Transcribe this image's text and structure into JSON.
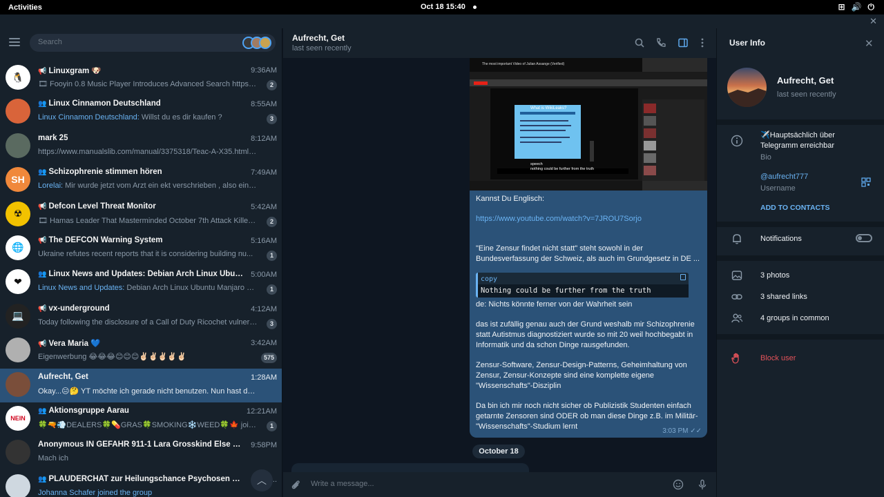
{
  "topbar": {
    "activities": "Activities",
    "clock": "Oct 18  15:40"
  },
  "search": {
    "placeholder": "Search"
  },
  "chats": [
    {
      "kind": "channel",
      "name": "Linuxgram 🐶",
      "time": "9:36AM",
      "preview_icon": "🎞",
      "preview": "Fooyin 0.8 Music Player Introduces Advanced Search https://l...",
      "sender": "",
      "badge": "2",
      "avatar_color": "#ffffff",
      "avatar_text": "🐧"
    },
    {
      "kind": "group",
      "name": "Linux Cinnamon Deutschland",
      "time": "8:55AM",
      "preview": "Willst du es dir kaufen ?",
      "sender": "Linux Cinnamon Deutschland:",
      "badge": "3",
      "avatar_color": "#d9643a",
      "avatar_text": ""
    },
    {
      "kind": "",
      "name": "mark 25",
      "time": "8:12AM",
      "preview": "https://www.manualslib.com/manual/3375318/Teac-A-X35.html?pag...",
      "sender": "",
      "badge": "",
      "avatar_color": "#5a6a60",
      "avatar_text": ""
    },
    {
      "kind": "group",
      "name": "Schizophrenie stimmen hören",
      "time": "7:49AM",
      "preview": "Mir wurde jetzt vom Arzt ein ekt verschrieben , also eine Str...",
      "sender": "Lorelai:",
      "badge": "",
      "avatar_color": "#f0883b",
      "avatar_text": "SH"
    },
    {
      "kind": "channel",
      "name": "Defcon Level Threat Monitor",
      "time": "5:42AM",
      "preview_icon": "🎞",
      "preview": "Hamas Leader That Masterminded October 7th Attack Killed ...",
      "sender": "",
      "badge": "2",
      "avatar_color": "#f2c200",
      "avatar_text": "☢"
    },
    {
      "kind": "channel",
      "name": "The DEFCON Warning System",
      "time": "5:16AM",
      "preview": "Ukraine refutes recent reports that it is considering building  nu...",
      "sender": "",
      "badge": "1",
      "avatar_color": "#ffffff",
      "avatar_text": "🌐"
    },
    {
      "kind": "group",
      "name": "Linux News and Updates: Debian Arch Linux Ubuntu ...",
      "time": "5:00AM",
      "preview": "Debian Arch Linux Ubuntu Manjaro G...",
      "sender": "Linux News and Updates:",
      "badge": "1",
      "avatar_color": "#ffffff",
      "avatar_text": "❤"
    },
    {
      "kind": "channel",
      "name": "vx-underground",
      "time": "4:12AM",
      "preview": "Today following the disclosure of a Call of Duty Ricochet vulnera...",
      "sender": "",
      "badge": "3",
      "avatar_color": "#222222",
      "avatar_text": "💻"
    },
    {
      "kind": "channel",
      "name": "Vera Maria 💙",
      "time": "3:42AM",
      "preview": "Eigenwerbung 😂😂😂😊😊😊✌🏻✌🏻✌🏻✌🏻✌🏻",
      "sender": "",
      "badge": "575",
      "avatar_color": "#b0b0b0",
      "avatar_text": ""
    },
    {
      "kind": "",
      "name": "Aufrecht, Get",
      "time": "1:28AM",
      "preview": "Okay...😑🤔 YT möchte ich gerade nicht benutzen. Nun hast du nic...",
      "sender": "",
      "badge": "",
      "avatar_color": "#7a4e3a",
      "avatar_text": "",
      "active": true
    },
    {
      "kind": "group",
      "name": "Aktionsgruppe Aarau",
      "time": "12:21AM",
      "preview": "🍀🔫💨DEALERS🍀💊GRAS🍀SMOKING❄️WEED🍀🍁 join...",
      "sender": "",
      "badge": "1",
      "avatar_color": "#ffffff",
      "avatar_text": "NEIN"
    },
    {
      "kind": "",
      "name": "Anonymous IN GEFAHR 911-1 Lara Grosskind Else Pö fran...",
      "time": "9:58PM",
      "preview": "Mach ich",
      "sender": "",
      "badge": "",
      "avatar_color": "#333333",
      "avatar_text": ""
    },
    {
      "kind": "group",
      "name": "PLAUDERCHAT zur Heilungschance Psychosen Gruppe...",
      "time": "9:...",
      "preview": "Johanna Schafer joined the group",
      "sender": "",
      "badge": "",
      "avatar_color": "#cfd8e0",
      "avatar_text": "",
      "preview_link": true
    }
  ],
  "chat": {
    "title": "Aufrecht, Get",
    "status": "last seen recently",
    "message": {
      "p1": "Kannst Du Englisch:",
      "link": "https://www.youtube.com/watch?v=7JROU7Sorjo",
      "p2": "\"Eine Zensur findet nicht statt\" steht sowohl in der Bundesverfassung der Schweiz, als auch im Grundgesetz in DE ...",
      "code_lang": "copy",
      "code": "Nothing could be further from the truth",
      "p3": "de: Nichts könnte ferner von der Wahrheit sein",
      "p4": "das ist zufällig genau auch der Grund weshalb mir Schizophrenie statt Autistmus diagnostiziert wurde so mit 20 weil hochbegabt in Informatik und da schon Dinge rausgefunden.",
      "p5": "Zensur-Software, Zensur-Design-Patterns, Geheimhaltung von Zensur, Zensur-Konzepte sind eine komplette eigene \"Wissenschafts\"-Disziplin",
      "p6": "Da bin ich mir noch nicht sicher ob Publizistik Studenten einfach getarnte Zensoren sind ODER ob man diese Dinge z.B. im Militär-\"Wissenschafts\"-Studium lernt",
      "time": "3:03 PM",
      "media": {
        "video_title": "The most important Video of Julian Assange (Verified)",
        "slide_title": "What is WikiLeaks?",
        "caption_1": "speech",
        "caption_2": "nothing could be further from the truth"
      }
    },
    "date_separator": "October 18",
    "composer_placeholder": "Write a message..."
  },
  "user_info": {
    "header": "User Info",
    "name": "Aufrecht, Get",
    "status": "last seen recently",
    "bio": "✈️Hauptsächlich über Telegramm erreichbar",
    "bio_label": "Bio",
    "username": "@aufrecht777",
    "username_label": "Username",
    "add_contacts": "ADD TO CONTACTS",
    "notifications": "Notifications",
    "notifications_on": false,
    "photos": "3 photos",
    "shared_links": "3 shared links",
    "groups": "4 groups in common",
    "block": "Block user"
  },
  "colors": {
    "accent": "#6ab3f3",
    "active_chat": "#2b5278",
    "danger": "#e5535a"
  }
}
